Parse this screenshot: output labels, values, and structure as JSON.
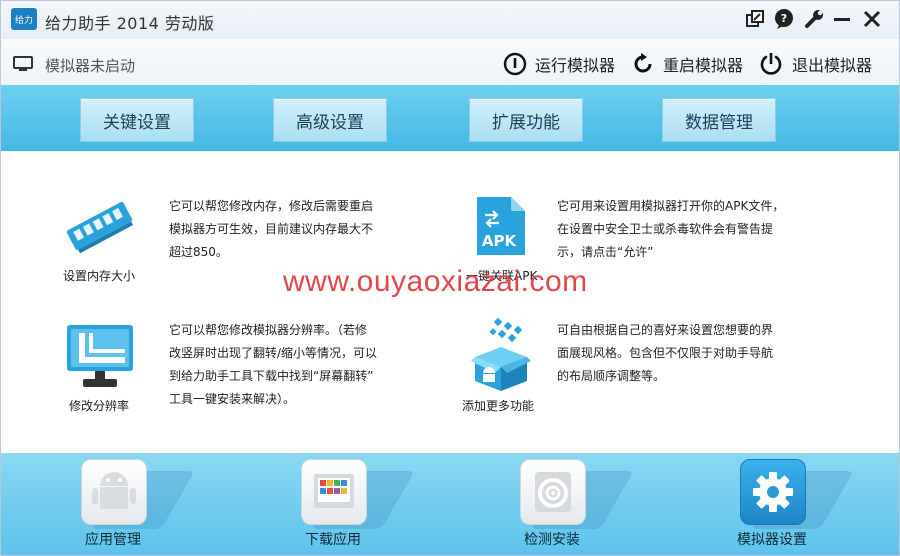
{
  "window": {
    "title": "给力助手 2014 劳动版",
    "logo_text": "给力"
  },
  "window_controls": [
    {
      "name": "restore",
      "icon": "window-restore-icon"
    },
    {
      "name": "feedback",
      "icon": "chat-bubble-icon"
    },
    {
      "name": "settings",
      "icon": "wrench-icon"
    },
    {
      "name": "minimize",
      "icon": "minimize-icon"
    },
    {
      "name": "close",
      "icon": "close-icon"
    }
  ],
  "status": {
    "text": "模拟器未启动",
    "icon": "monitor-icon"
  },
  "toolbar": {
    "run_label": "运行模拟器",
    "restart_label": "重启模拟器",
    "exit_label": "退出模拟器"
  },
  "tabs": [
    {
      "label": "关键设置"
    },
    {
      "label": "高级设置"
    },
    {
      "label": "扩展功能"
    },
    {
      "label": "数据管理"
    }
  ],
  "features": [
    {
      "label": "设置内存大小",
      "icon": "memory-stick-icon",
      "desc": [
        "它可以帮您修改内存，修改后需要重启",
        "模拟器方可生效，目前建议内存最大不",
        "超过850。"
      ]
    },
    {
      "label": "一键关联APK",
      "icon": "apk-file-icon",
      "icon_text": "APK",
      "desc": [
        "它可用来设置用模拟器打开你的APK文件，",
        "在设置中安全卫士或杀毒软件会有警告提",
        "示，请点击“允许”"
      ]
    },
    {
      "label": "修改分辨率",
      "icon": "resolution-monitor-icon",
      "desc": [
        "它可以帮您修改模拟器分辨率。（若修",
        "改竖屏时出现了翻转/缩小等情况，可以",
        "到给力助手工具下载中找到“屏幕翻转”",
        "工具一键安装来解决）。"
      ]
    },
    {
      "label": "添加更多功能",
      "icon": "android-box-icon",
      "desc": [
        "可自由根据自己的喜好来设置您想要的界",
        "面展现风格。包含但不仅限于对助手导航",
        "的布局顺序调整等。"
      ]
    }
  ],
  "watermark": "www.ouyaoxiazai.com",
  "bottom_nav": [
    {
      "label": "应用管理",
      "icon": "app-management-icon"
    },
    {
      "label": "下载应用",
      "icon": "download-apps-icon"
    },
    {
      "label": "检测安装",
      "icon": "detect-install-icon"
    },
    {
      "label": "模拟器设置",
      "icon": "gear-icon"
    }
  ],
  "colors": {
    "tab_band": "#44b8e4",
    "bottom_band": "#5ec3ea",
    "accent_blue": "#2aa3dc",
    "watermark": "#e2474a"
  }
}
